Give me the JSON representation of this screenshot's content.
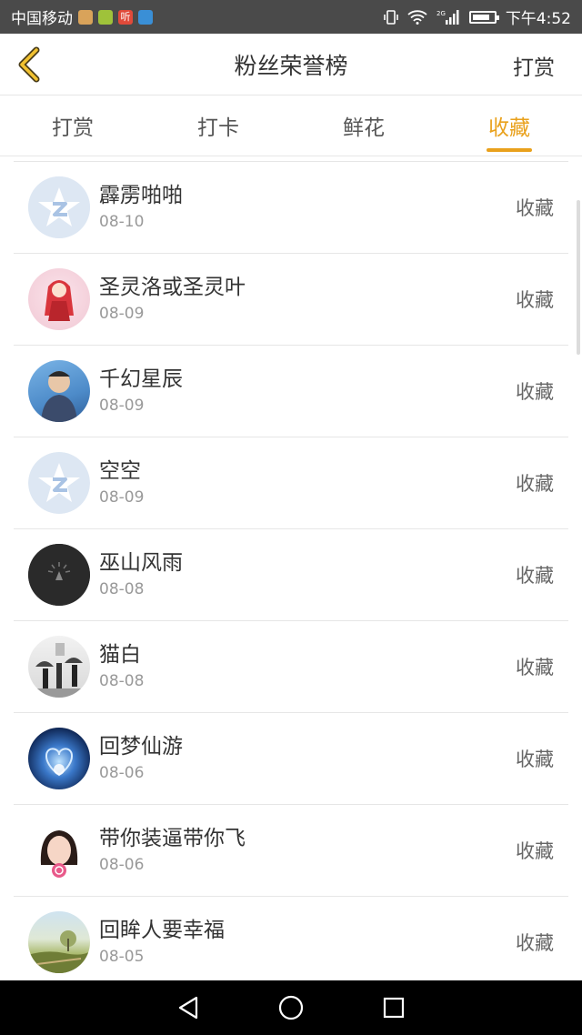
{
  "status_bar": {
    "carrier": "中国移动",
    "time": "下午4:52",
    "network": "2G"
  },
  "header": {
    "title": "粉丝荣誉榜",
    "right_action": "打赏"
  },
  "tabs": [
    {
      "label": "打赏",
      "active": false
    },
    {
      "label": "打卡",
      "active": false
    },
    {
      "label": "鲜花",
      "active": false
    },
    {
      "label": "收藏",
      "active": true
    }
  ],
  "colors": {
    "accent": "#e9a11c",
    "status_bar": "#4a4a4a"
  },
  "fans": [
    {
      "name": "霹雳啪啪",
      "date": "08-10",
      "action": "收藏",
      "avatar": "default-q-avatar"
    },
    {
      "name": "圣灵洛或圣灵叶",
      "date": "08-09",
      "action": "收藏",
      "avatar": "anime-girl-avatar"
    },
    {
      "name": "千幻星辰",
      "date": "08-09",
      "action": "收藏",
      "avatar": "child-photo-avatar"
    },
    {
      "name": "空空",
      "date": "08-09",
      "action": "收藏",
      "avatar": "default-q-avatar"
    },
    {
      "name": "巫山风雨",
      "date": "08-08",
      "action": "收藏",
      "avatar": "dark-bulb-avatar"
    },
    {
      "name": "猫白",
      "date": "08-08",
      "action": "收藏",
      "avatar": "umbrella-people-avatar"
    },
    {
      "name": "回梦仙游",
      "date": "08-06",
      "action": "收藏",
      "avatar": "blue-heart-avatar"
    },
    {
      "name": "带你装逼带你飞",
      "date": "08-06",
      "action": "收藏",
      "avatar": "girl-lollipop-avatar"
    },
    {
      "name": "回眸人要幸福",
      "date": "08-05",
      "action": "收藏",
      "avatar": "landscape-avatar"
    }
  ]
}
